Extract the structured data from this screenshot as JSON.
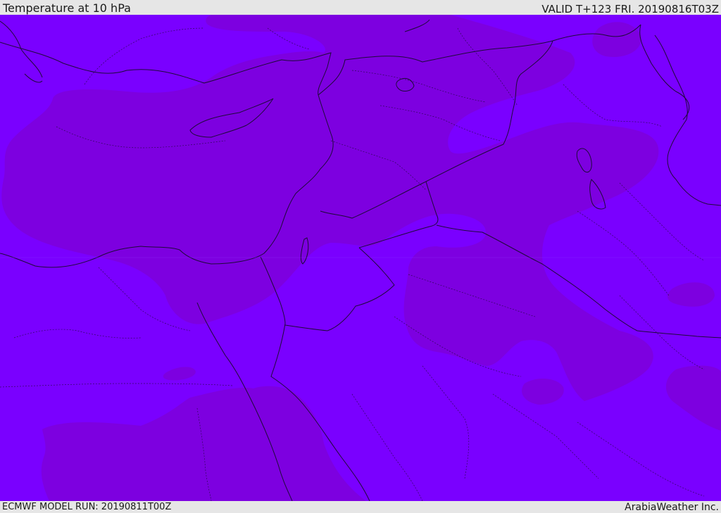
{
  "header": {
    "title": "Temperature at 10 hPa",
    "valid": "VALID T+123 FRI. 20190816T03Z"
  },
  "footer": {
    "model_run": "ECMWF MODEL RUN: 20190811T00Z",
    "credit": "ArabiaWeather Inc."
  },
  "colors": {
    "field_base": "#7a00ff",
    "field_cold": "#7d00e0",
    "coastline": "#1f0a3a",
    "border": "#1f0a3a",
    "bar_background": "#e6e6e6",
    "bar_text": "#1a1a1a"
  }
}
